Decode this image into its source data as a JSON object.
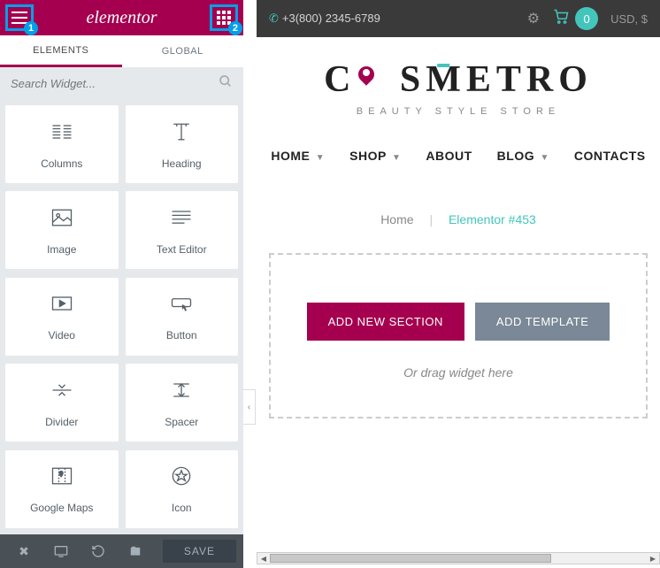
{
  "sidebar": {
    "logo": "elementor",
    "annotations": {
      "menu": "1",
      "grid": "2"
    },
    "tabs": {
      "elements": "ELEMENTS",
      "global": "GLOBAL"
    },
    "search_placeholder": "Search Widget...",
    "widgets": [
      {
        "label": "Columns",
        "icon": "columns"
      },
      {
        "label": "Heading",
        "icon": "heading"
      },
      {
        "label": "Image",
        "icon": "image"
      },
      {
        "label": "Text Editor",
        "icon": "text-editor"
      },
      {
        "label": "Video",
        "icon": "video"
      },
      {
        "label": "Button",
        "icon": "button"
      },
      {
        "label": "Divider",
        "icon": "divider"
      },
      {
        "label": "Spacer",
        "icon": "spacer"
      },
      {
        "label": "Google Maps",
        "icon": "google-maps"
      },
      {
        "label": "Icon",
        "icon": "icon"
      }
    ],
    "save_label": "SAVE"
  },
  "preview": {
    "phone": "+3(800) 2345-6789",
    "cart_count": "0",
    "currency": "USD, $",
    "brand": "COSMETRO",
    "tagline": "BEAUTY STYLE STORE",
    "nav": [
      {
        "label": "HOME",
        "dropdown": true
      },
      {
        "label": "SHOP",
        "dropdown": true
      },
      {
        "label": "ABOUT",
        "dropdown": false
      },
      {
        "label": "BLOG",
        "dropdown": true
      },
      {
        "label": "CONTACTS",
        "dropdown": false
      }
    ],
    "breadcrumb": {
      "home": "Home",
      "current": "Elementor #453"
    },
    "drop": {
      "add_section": "ADD NEW SECTION",
      "add_template": "ADD TEMPLATE",
      "hint": "Or drag widget here"
    }
  }
}
